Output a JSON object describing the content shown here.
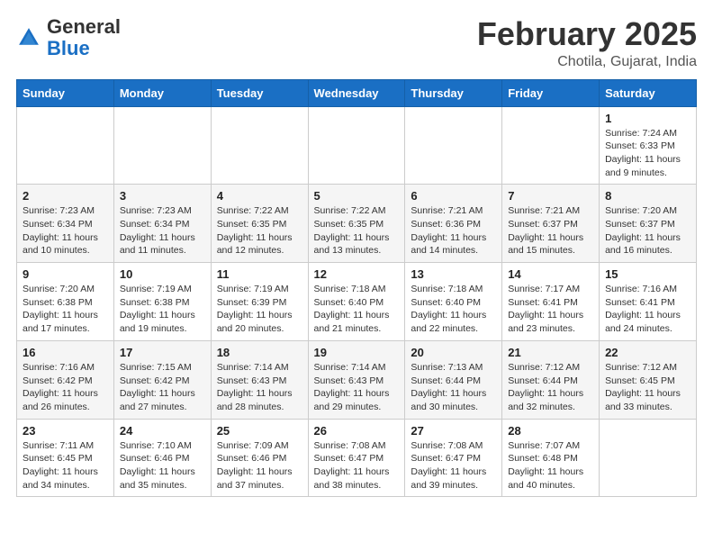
{
  "header": {
    "logo_text_general": "General",
    "logo_text_blue": "Blue",
    "month_title": "February 2025",
    "location": "Chotila, Gujarat, India"
  },
  "calendar": {
    "days_of_week": [
      "Sunday",
      "Monday",
      "Tuesday",
      "Wednesday",
      "Thursday",
      "Friday",
      "Saturday"
    ],
    "weeks": [
      [
        {
          "day": "",
          "info": ""
        },
        {
          "day": "",
          "info": ""
        },
        {
          "day": "",
          "info": ""
        },
        {
          "day": "",
          "info": ""
        },
        {
          "day": "",
          "info": ""
        },
        {
          "day": "",
          "info": ""
        },
        {
          "day": "1",
          "info": "Sunrise: 7:24 AM\nSunset: 6:33 PM\nDaylight: 11 hours\nand 9 minutes."
        }
      ],
      [
        {
          "day": "2",
          "info": "Sunrise: 7:23 AM\nSunset: 6:34 PM\nDaylight: 11 hours\nand 10 minutes."
        },
        {
          "day": "3",
          "info": "Sunrise: 7:23 AM\nSunset: 6:34 PM\nDaylight: 11 hours\nand 11 minutes."
        },
        {
          "day": "4",
          "info": "Sunrise: 7:22 AM\nSunset: 6:35 PM\nDaylight: 11 hours\nand 12 minutes."
        },
        {
          "day": "5",
          "info": "Sunrise: 7:22 AM\nSunset: 6:35 PM\nDaylight: 11 hours\nand 13 minutes."
        },
        {
          "day": "6",
          "info": "Sunrise: 7:21 AM\nSunset: 6:36 PM\nDaylight: 11 hours\nand 14 minutes."
        },
        {
          "day": "7",
          "info": "Sunrise: 7:21 AM\nSunset: 6:37 PM\nDaylight: 11 hours\nand 15 minutes."
        },
        {
          "day": "8",
          "info": "Sunrise: 7:20 AM\nSunset: 6:37 PM\nDaylight: 11 hours\nand 16 minutes."
        }
      ],
      [
        {
          "day": "9",
          "info": "Sunrise: 7:20 AM\nSunset: 6:38 PM\nDaylight: 11 hours\nand 17 minutes."
        },
        {
          "day": "10",
          "info": "Sunrise: 7:19 AM\nSunset: 6:38 PM\nDaylight: 11 hours\nand 19 minutes."
        },
        {
          "day": "11",
          "info": "Sunrise: 7:19 AM\nSunset: 6:39 PM\nDaylight: 11 hours\nand 20 minutes."
        },
        {
          "day": "12",
          "info": "Sunrise: 7:18 AM\nSunset: 6:40 PM\nDaylight: 11 hours\nand 21 minutes."
        },
        {
          "day": "13",
          "info": "Sunrise: 7:18 AM\nSunset: 6:40 PM\nDaylight: 11 hours\nand 22 minutes."
        },
        {
          "day": "14",
          "info": "Sunrise: 7:17 AM\nSunset: 6:41 PM\nDaylight: 11 hours\nand 23 minutes."
        },
        {
          "day": "15",
          "info": "Sunrise: 7:16 AM\nSunset: 6:41 PM\nDaylight: 11 hours\nand 24 minutes."
        }
      ],
      [
        {
          "day": "16",
          "info": "Sunrise: 7:16 AM\nSunset: 6:42 PM\nDaylight: 11 hours\nand 26 minutes."
        },
        {
          "day": "17",
          "info": "Sunrise: 7:15 AM\nSunset: 6:42 PM\nDaylight: 11 hours\nand 27 minutes."
        },
        {
          "day": "18",
          "info": "Sunrise: 7:14 AM\nSunset: 6:43 PM\nDaylight: 11 hours\nand 28 minutes."
        },
        {
          "day": "19",
          "info": "Sunrise: 7:14 AM\nSunset: 6:43 PM\nDaylight: 11 hours\nand 29 minutes."
        },
        {
          "day": "20",
          "info": "Sunrise: 7:13 AM\nSunset: 6:44 PM\nDaylight: 11 hours\nand 30 minutes."
        },
        {
          "day": "21",
          "info": "Sunrise: 7:12 AM\nSunset: 6:44 PM\nDaylight: 11 hours\nand 32 minutes."
        },
        {
          "day": "22",
          "info": "Sunrise: 7:12 AM\nSunset: 6:45 PM\nDaylight: 11 hours\nand 33 minutes."
        }
      ],
      [
        {
          "day": "23",
          "info": "Sunrise: 7:11 AM\nSunset: 6:45 PM\nDaylight: 11 hours\nand 34 minutes."
        },
        {
          "day": "24",
          "info": "Sunrise: 7:10 AM\nSunset: 6:46 PM\nDaylight: 11 hours\nand 35 minutes."
        },
        {
          "day": "25",
          "info": "Sunrise: 7:09 AM\nSunset: 6:46 PM\nDaylight: 11 hours\nand 37 minutes."
        },
        {
          "day": "26",
          "info": "Sunrise: 7:08 AM\nSunset: 6:47 PM\nDaylight: 11 hours\nand 38 minutes."
        },
        {
          "day": "27",
          "info": "Sunrise: 7:08 AM\nSunset: 6:47 PM\nDaylight: 11 hours\nand 39 minutes."
        },
        {
          "day": "28",
          "info": "Sunrise: 7:07 AM\nSunset: 6:48 PM\nDaylight: 11 hours\nand 40 minutes."
        },
        {
          "day": "",
          "info": ""
        }
      ]
    ]
  }
}
